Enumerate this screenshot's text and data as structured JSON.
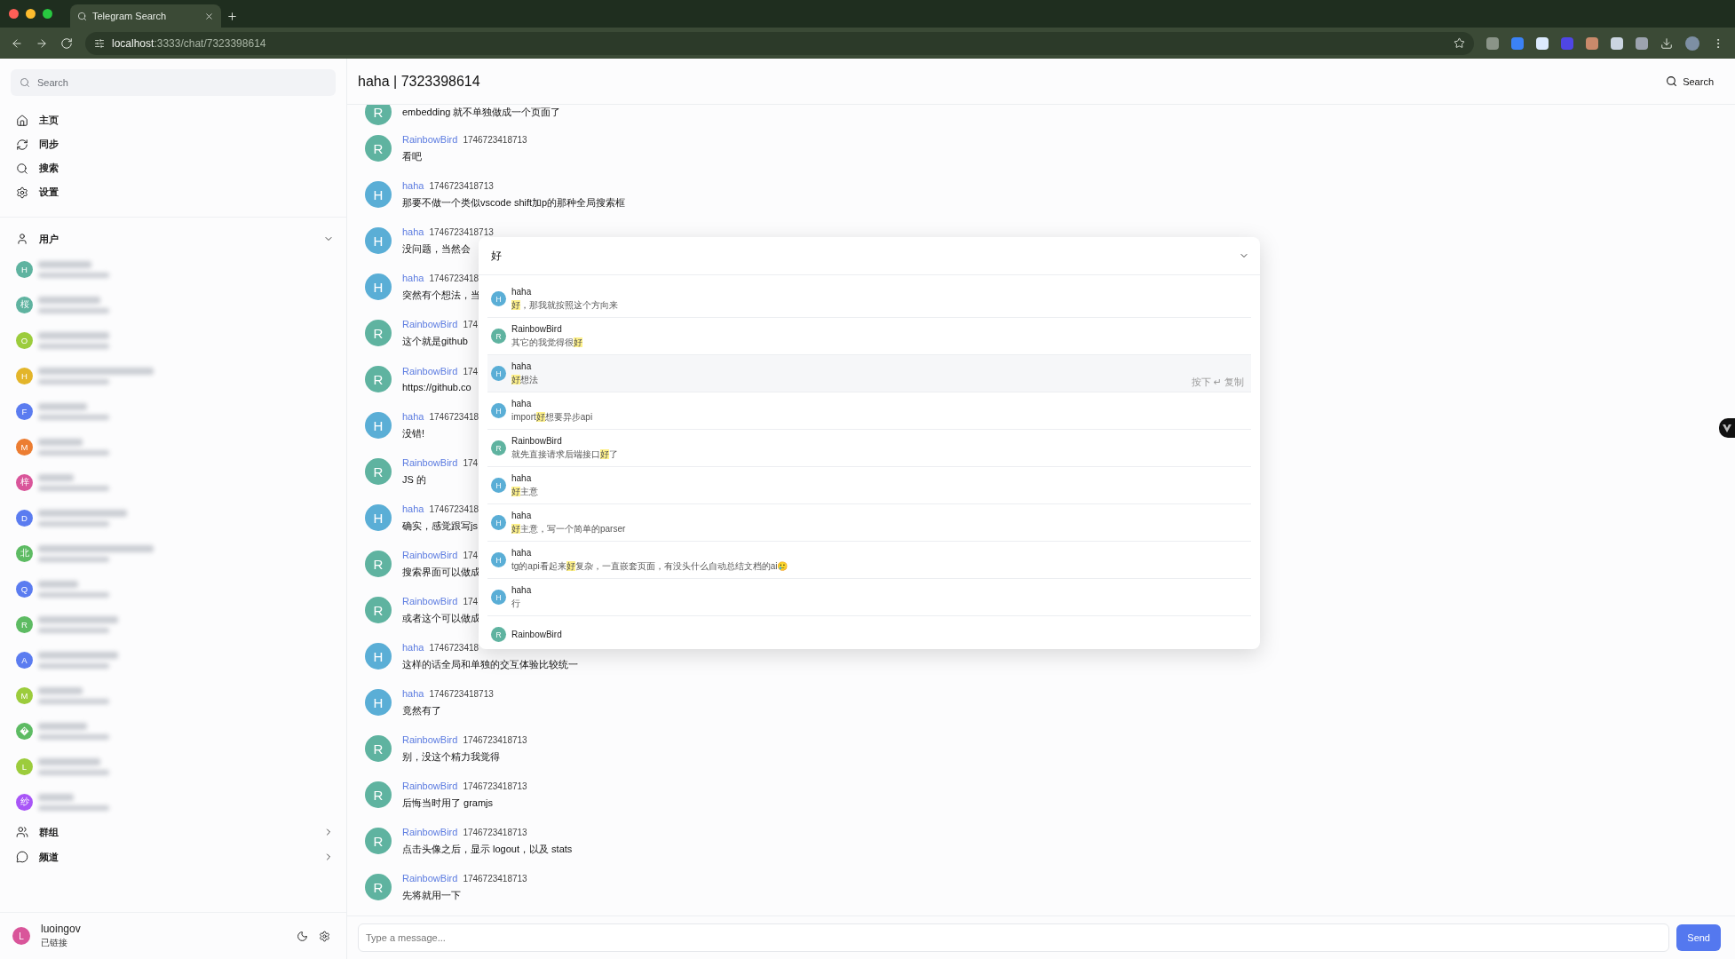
{
  "browser": {
    "tab": {
      "title": "Telegram Search"
    },
    "url": {
      "host": "localhost",
      "path": ":3333/chat/7323398614"
    }
  },
  "sidebar": {
    "search": {
      "placeholder": "Search"
    },
    "nav": [
      {
        "label": "主页"
      },
      {
        "label": "同步"
      },
      {
        "label": "搜索"
      },
      {
        "label": "设置"
      }
    ],
    "sections": [
      {
        "label": "用户",
        "expanded": true,
        "items": [
          {
            "avatar": "H",
            "color": "#5fb3a0"
          },
          {
            "avatar": "桜",
            "color": "#5fb3a0"
          },
          {
            "avatar": "O",
            "color": "#9ccc3c"
          },
          {
            "avatar": "H",
            "color": "#e3b52a"
          },
          {
            "avatar": "F",
            "color": "#5b7cf0"
          },
          {
            "avatar": "M",
            "color": "#ec7d32"
          },
          {
            "avatar": "梓",
            "color": "#d9559a"
          },
          {
            "avatar": "D",
            "color": "#5b7cf0"
          },
          {
            "avatar": "北",
            "color": "#5dbb63"
          },
          {
            "avatar": "Q",
            "color": "#5b7cf0"
          },
          {
            "avatar": "R",
            "color": "#5dbb63"
          },
          {
            "avatar": "A",
            "color": "#5b7cf0"
          },
          {
            "avatar": "M",
            "color": "#9ccc3c"
          },
          {
            "color": "#5dbb63"
          },
          {
            "avatar": "L",
            "color": "#9ccc3c"
          },
          {
            "avatar": "纱",
            "color": "#a855f7"
          }
        ]
      },
      {
        "label": "群组",
        "expanded": false
      },
      {
        "label": "频道",
        "expanded": false
      }
    ],
    "account": {
      "avatar": "L",
      "color": "#d9559a",
      "name": "luoingov",
      "status": "已链接"
    }
  },
  "chat": {
    "title": "haha | 7323398614",
    "search_button": "Search",
    "messages": [
      {
        "avatar": "R",
        "color": "#5fb3a0",
        "text": "embedding 就不单独做成一个页面了"
      },
      {
        "sender": "RainbowBird",
        "avatar": "R",
        "color": "#5fb3a0",
        "time": "1746723418713",
        "text": "看吧"
      },
      {
        "sender": "haha",
        "avatar": "H",
        "color": "#5aaed6",
        "time": "1746723418713",
        "text": "那要不做一个类似vscode shift加p的那种全局搜索框"
      },
      {
        "sender": "haha",
        "avatar": "H",
        "color": "#5aaed6",
        "time": "1746723418713",
        "text": "没问题，当然会"
      },
      {
        "sender": "haha",
        "avatar": "H",
        "color": "#5aaed6",
        "time": "1746723418",
        "text": "突然有个想法，当"
      },
      {
        "sender": "RainbowBird",
        "avatar": "R",
        "color": "#5fb3a0",
        "time": "174",
        "text": "这个就是github"
      },
      {
        "sender": "RainbowBird",
        "avatar": "R",
        "color": "#5fb3a0",
        "time": "174",
        "text": "https://github.co"
      },
      {
        "sender": "haha",
        "avatar": "H",
        "color": "#5aaed6",
        "time": "1746723418",
        "text": "没错!"
      },
      {
        "sender": "RainbowBird",
        "avatar": "R",
        "color": "#5fb3a0",
        "time": "174",
        "text": "JS 的"
      },
      {
        "sender": "haha",
        "avatar": "H",
        "color": "#5aaed6",
        "time": "1746723418",
        "text": "确实，感觉跟写js"
      },
      {
        "sender": "RainbowBird",
        "avatar": "R",
        "color": "#5fb3a0",
        "time": "174",
        "text": "搜索界面可以做成"
      },
      {
        "sender": "RainbowBird",
        "avatar": "R",
        "color": "#5fb3a0",
        "time": "174",
        "text": "或者这个可以做成"
      },
      {
        "sender": "haha",
        "avatar": "H",
        "color": "#5aaed6",
        "time": "1746723418",
        "text": "这样的话全局和单独的交互体验比较统一"
      },
      {
        "sender": "haha",
        "avatar": "H",
        "color": "#5aaed6",
        "time": "1746723418713",
        "text": "竟然有了"
      },
      {
        "sender": "RainbowBird",
        "avatar": "R",
        "color": "#5fb3a0",
        "time": "1746723418713",
        "text": "别，没这个精力我觉得"
      },
      {
        "sender": "RainbowBird",
        "avatar": "R",
        "color": "#5fb3a0",
        "time": "1746723418713",
        "text": "后悔当时用了 gramjs"
      },
      {
        "sender": "RainbowBird",
        "avatar": "R",
        "color": "#5fb3a0",
        "time": "1746723418713",
        "text": "点击头像之后，显示 logout，以及 stats"
      },
      {
        "sender": "RainbowBird",
        "avatar": "R",
        "color": "#5fb3a0",
        "time": "1746723418713",
        "text": "先将就用一下"
      }
    ],
    "composer": {
      "placeholder": "Type a message...",
      "send": "Send"
    }
  },
  "search_popup": {
    "query": "好",
    "hint": "按下 ↵ 复制",
    "results": [
      {
        "sender": "haha",
        "avatar": "H",
        "color": "#5aaed6",
        "selected": false,
        "parts": [
          {
            "text": "好",
            "highlight": true
          },
          {
            "text": "，那我就按照这个方向来",
            "highlight": false
          }
        ]
      },
      {
        "sender": "RainbowBird",
        "avatar": "R",
        "color": "#5fb3a0",
        "selected": false,
        "parts": [
          {
            "text": "其它的我觉得很",
            "highlight": false
          },
          {
            "text": "好",
            "highlight": true
          }
        ]
      },
      {
        "sender": "haha",
        "avatar": "H",
        "color": "#5aaed6",
        "selected": true,
        "parts": [
          {
            "text": "好",
            "highlight": true
          },
          {
            "text": "想法",
            "highlight": false
          }
        ]
      },
      {
        "sender": "haha",
        "avatar": "H",
        "color": "#5aaed6",
        "selected": false,
        "parts": [
          {
            "text": "import",
            "highlight": false
          },
          {
            "text": "好",
            "highlight": true
          },
          {
            "text": "想要异步api",
            "highlight": false
          }
        ]
      },
      {
        "sender": "RainbowBird",
        "avatar": "R",
        "color": "#5fb3a0",
        "selected": false,
        "parts": [
          {
            "text": "就先直接请求后端接口",
            "highlight": false
          },
          {
            "text": "好",
            "highlight": true
          },
          {
            "text": "了",
            "highlight": false
          }
        ]
      },
      {
        "sender": "haha",
        "avatar": "H",
        "color": "#5aaed6",
        "selected": false,
        "parts": [
          {
            "text": "好",
            "highlight": true
          },
          {
            "text": "主意",
            "highlight": false
          }
        ]
      },
      {
        "sender": "haha",
        "avatar": "H",
        "color": "#5aaed6",
        "selected": false,
        "parts": [
          {
            "text": "好",
            "highlight": true
          },
          {
            "text": "主意，写一个简单的parser",
            "highlight": false
          }
        ]
      },
      {
        "sender": "haha",
        "avatar": "H",
        "color": "#5aaed6",
        "selected": false,
        "parts": [
          {
            "text": "tg的api看起来",
            "highlight": false
          },
          {
            "text": "好",
            "highlight": true
          },
          {
            "text": "复杂，一直嵌套页面，有没头什么自动总结文档的ai🥲",
            "highlight": false
          }
        ]
      },
      {
        "sender": "haha",
        "avatar": "H",
        "color": "#5aaed6",
        "selected": false,
        "parts": [
          {
            "text": "行",
            "highlight": false
          }
        ]
      },
      {
        "sender": "RainbowBird",
        "avatar": "R",
        "color": "#5fb3a0",
        "selected": false
      }
    ]
  }
}
